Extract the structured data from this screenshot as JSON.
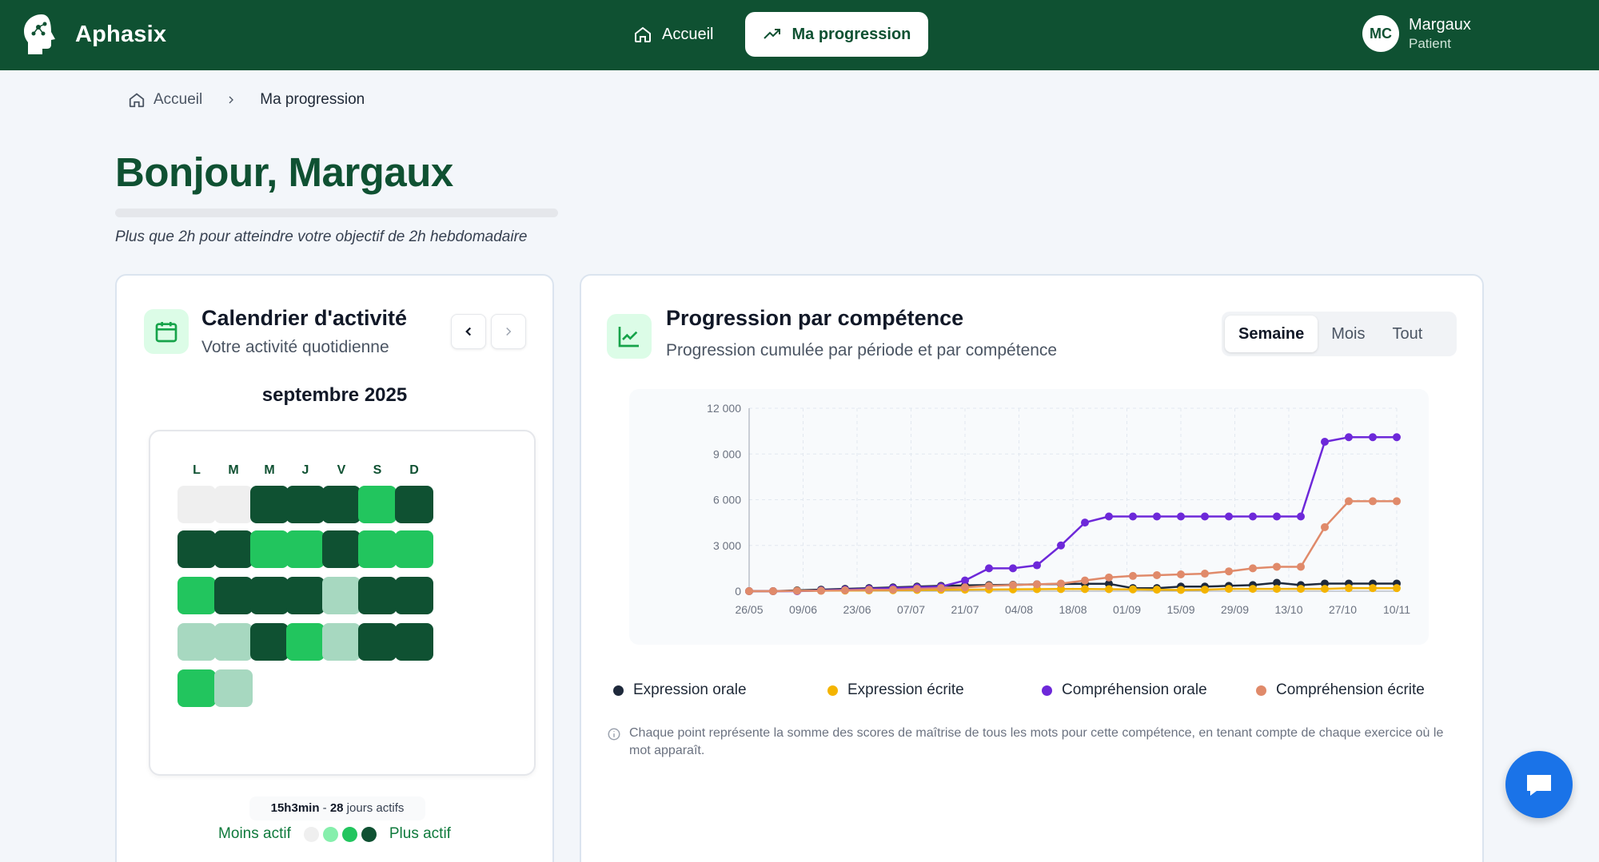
{
  "app": {
    "name": "Aphasix"
  },
  "nav": {
    "home": "Accueil",
    "progress": "Ma progression"
  },
  "user": {
    "initials": "MC",
    "name": "Margaux",
    "role": "Patient"
  },
  "breadcrumb": {
    "home": "Accueil",
    "current": "Ma progression"
  },
  "greeting": "Bonjour, Margaux",
  "goal": {
    "text": "Plus que 2h pour atteindre votre objectif de 2h hebdomadaire",
    "progress": 0
  },
  "calendar": {
    "title": "Calendrier d'activité",
    "subtitle": "Votre activité quotidienne",
    "month": "septembre 2025",
    "weekdays": [
      "L",
      "M",
      "M",
      "J",
      "V",
      "S",
      "D"
    ],
    "levels": [
      [
        0,
        0,
        4,
        4,
        4,
        3,
        4
      ],
      [
        4,
        4,
        3,
        3,
        4,
        3,
        3
      ],
      [
        3,
        4,
        4,
        4,
        1,
        4,
        4
      ],
      [
        1,
        1,
        4,
        3,
        1,
        4,
        4
      ],
      [
        3,
        1
      ]
    ],
    "summary_time": "15h3min",
    "summary_sep": " - ",
    "summary_days": "28",
    "summary_days_label": " jours actifs",
    "legend_less": "Moins actif",
    "legend_more": "Plus actif",
    "level_colors": [
      "#efefef",
      "#a7d8c0",
      "#86efac",
      "#22c55e",
      "#0f5132"
    ]
  },
  "progress": {
    "title": "Progression par compétence",
    "subtitle": "Progression cumulée par période et par compétence",
    "periods": [
      "Semaine",
      "Mois",
      "Tout"
    ],
    "active_period": "Semaine",
    "note": "Chaque point représente la somme des scores de maîtrise de tous les mots pour cette compétence, en tenant compte de chaque exercice où le mot apparaît."
  },
  "chart_data": {
    "type": "line",
    "x_tick_labels": [
      "26/05",
      "09/06",
      "23/06",
      "07/07",
      "21/07",
      "04/08",
      "18/08",
      "01/09",
      "15/09",
      "29/09",
      "13/10",
      "27/10",
      "10/11"
    ],
    "y_ticks": [
      0,
      3000,
      6000,
      9000,
      12000
    ],
    "y_tick_labels": [
      "0",
      "3 000",
      "6 000",
      "9 000",
      "12 000"
    ],
    "ylim": [
      0,
      12000
    ],
    "grid": true,
    "legend_position": "bottom",
    "series": [
      {
        "name": "Expression orale",
        "color": "#1e293b",
        "values": [
          0,
          0,
          50,
          100,
          150,
          200,
          250,
          300,
          350,
          380,
          400,
          420,
          450,
          470,
          480,
          480,
          200,
          200,
          300,
          300,
          350,
          400,
          550,
          400,
          500,
          500,
          500,
          500
        ]
      },
      {
        "name": "Expression écrite",
        "color": "#f4b400",
        "values": [
          0,
          0,
          20,
          30,
          40,
          50,
          60,
          80,
          90,
          100,
          110,
          120,
          130,
          140,
          140,
          130,
          120,
          100,
          80,
          100,
          150,
          150,
          150,
          150,
          150,
          200,
          200,
          200
        ]
      },
      {
        "name": "Compréhension orale",
        "color": "#6d28d9",
        "values": [
          0,
          0,
          0,
          50,
          100,
          150,
          200,
          250,
          300,
          700,
          1500,
          1500,
          1700,
          3000,
          4500,
          4900,
          4900,
          4900,
          4900,
          4900,
          4900,
          4900,
          4900,
          4900,
          9800,
          10100,
          10100,
          10100
        ]
      },
      {
        "name": "Compréhension écrite",
        "color": "#e08a6a",
        "values": [
          0,
          0,
          20,
          30,
          60,
          90,
          100,
          150,
          200,
          250,
          350,
          400,
          450,
          500,
          700,
          900,
          1000,
          1050,
          1100,
          1150,
          1300,
          1500,
          1600,
          1600,
          4200,
          5900,
          5900,
          5900
        ]
      }
    ]
  }
}
